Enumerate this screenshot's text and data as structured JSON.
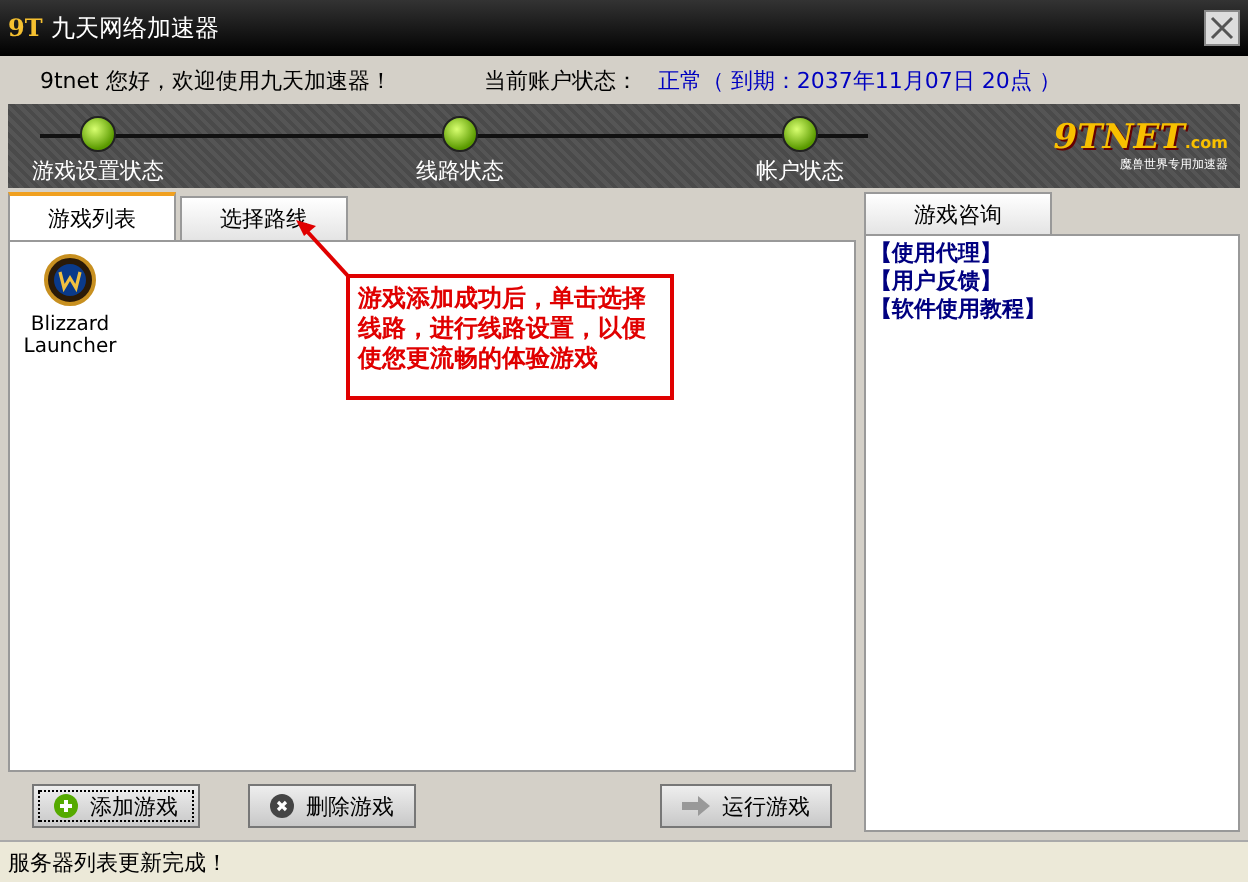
{
  "window": {
    "logo": "9T",
    "title": "九天网络加速器"
  },
  "info": {
    "greeting": "9tnet 您好，欢迎使用九天加速器！",
    "status_label": "当前账户状态：",
    "status_value": "正常（ 到期：2037年11月07日 20点 ）"
  },
  "steps": [
    {
      "label": "游戏设置状态",
      "on": true
    },
    {
      "label": "线路状态",
      "on": true
    },
    {
      "label": "帐户状态",
      "on": true
    }
  ],
  "brand": {
    "name": "9TNET",
    "suffix": ".com",
    "tagline": "魔兽世界专用加速器"
  },
  "tabs": [
    {
      "label": "游戏列表",
      "selected": true
    },
    {
      "label": "选择路线",
      "selected": false
    }
  ],
  "games": [
    {
      "name": "Blizzard Launcher"
    }
  ],
  "callout": "游戏添加成功后，单击选择线路，进行线路设置，以便使您更流畅的体验游戏",
  "buttons": [
    {
      "label": "添加游戏",
      "kind": "add",
      "focused": true
    },
    {
      "label": "删除游戏",
      "kind": "delete",
      "focused": false
    },
    {
      "label": "运行游戏",
      "kind": "run",
      "focused": false
    }
  ],
  "side": {
    "tab": "游戏咨询",
    "links": [
      "【使用代理】",
      "【用户反馈】",
      "【软件使用教程】"
    ]
  },
  "status_bar": "服务器列表更新完成！"
}
